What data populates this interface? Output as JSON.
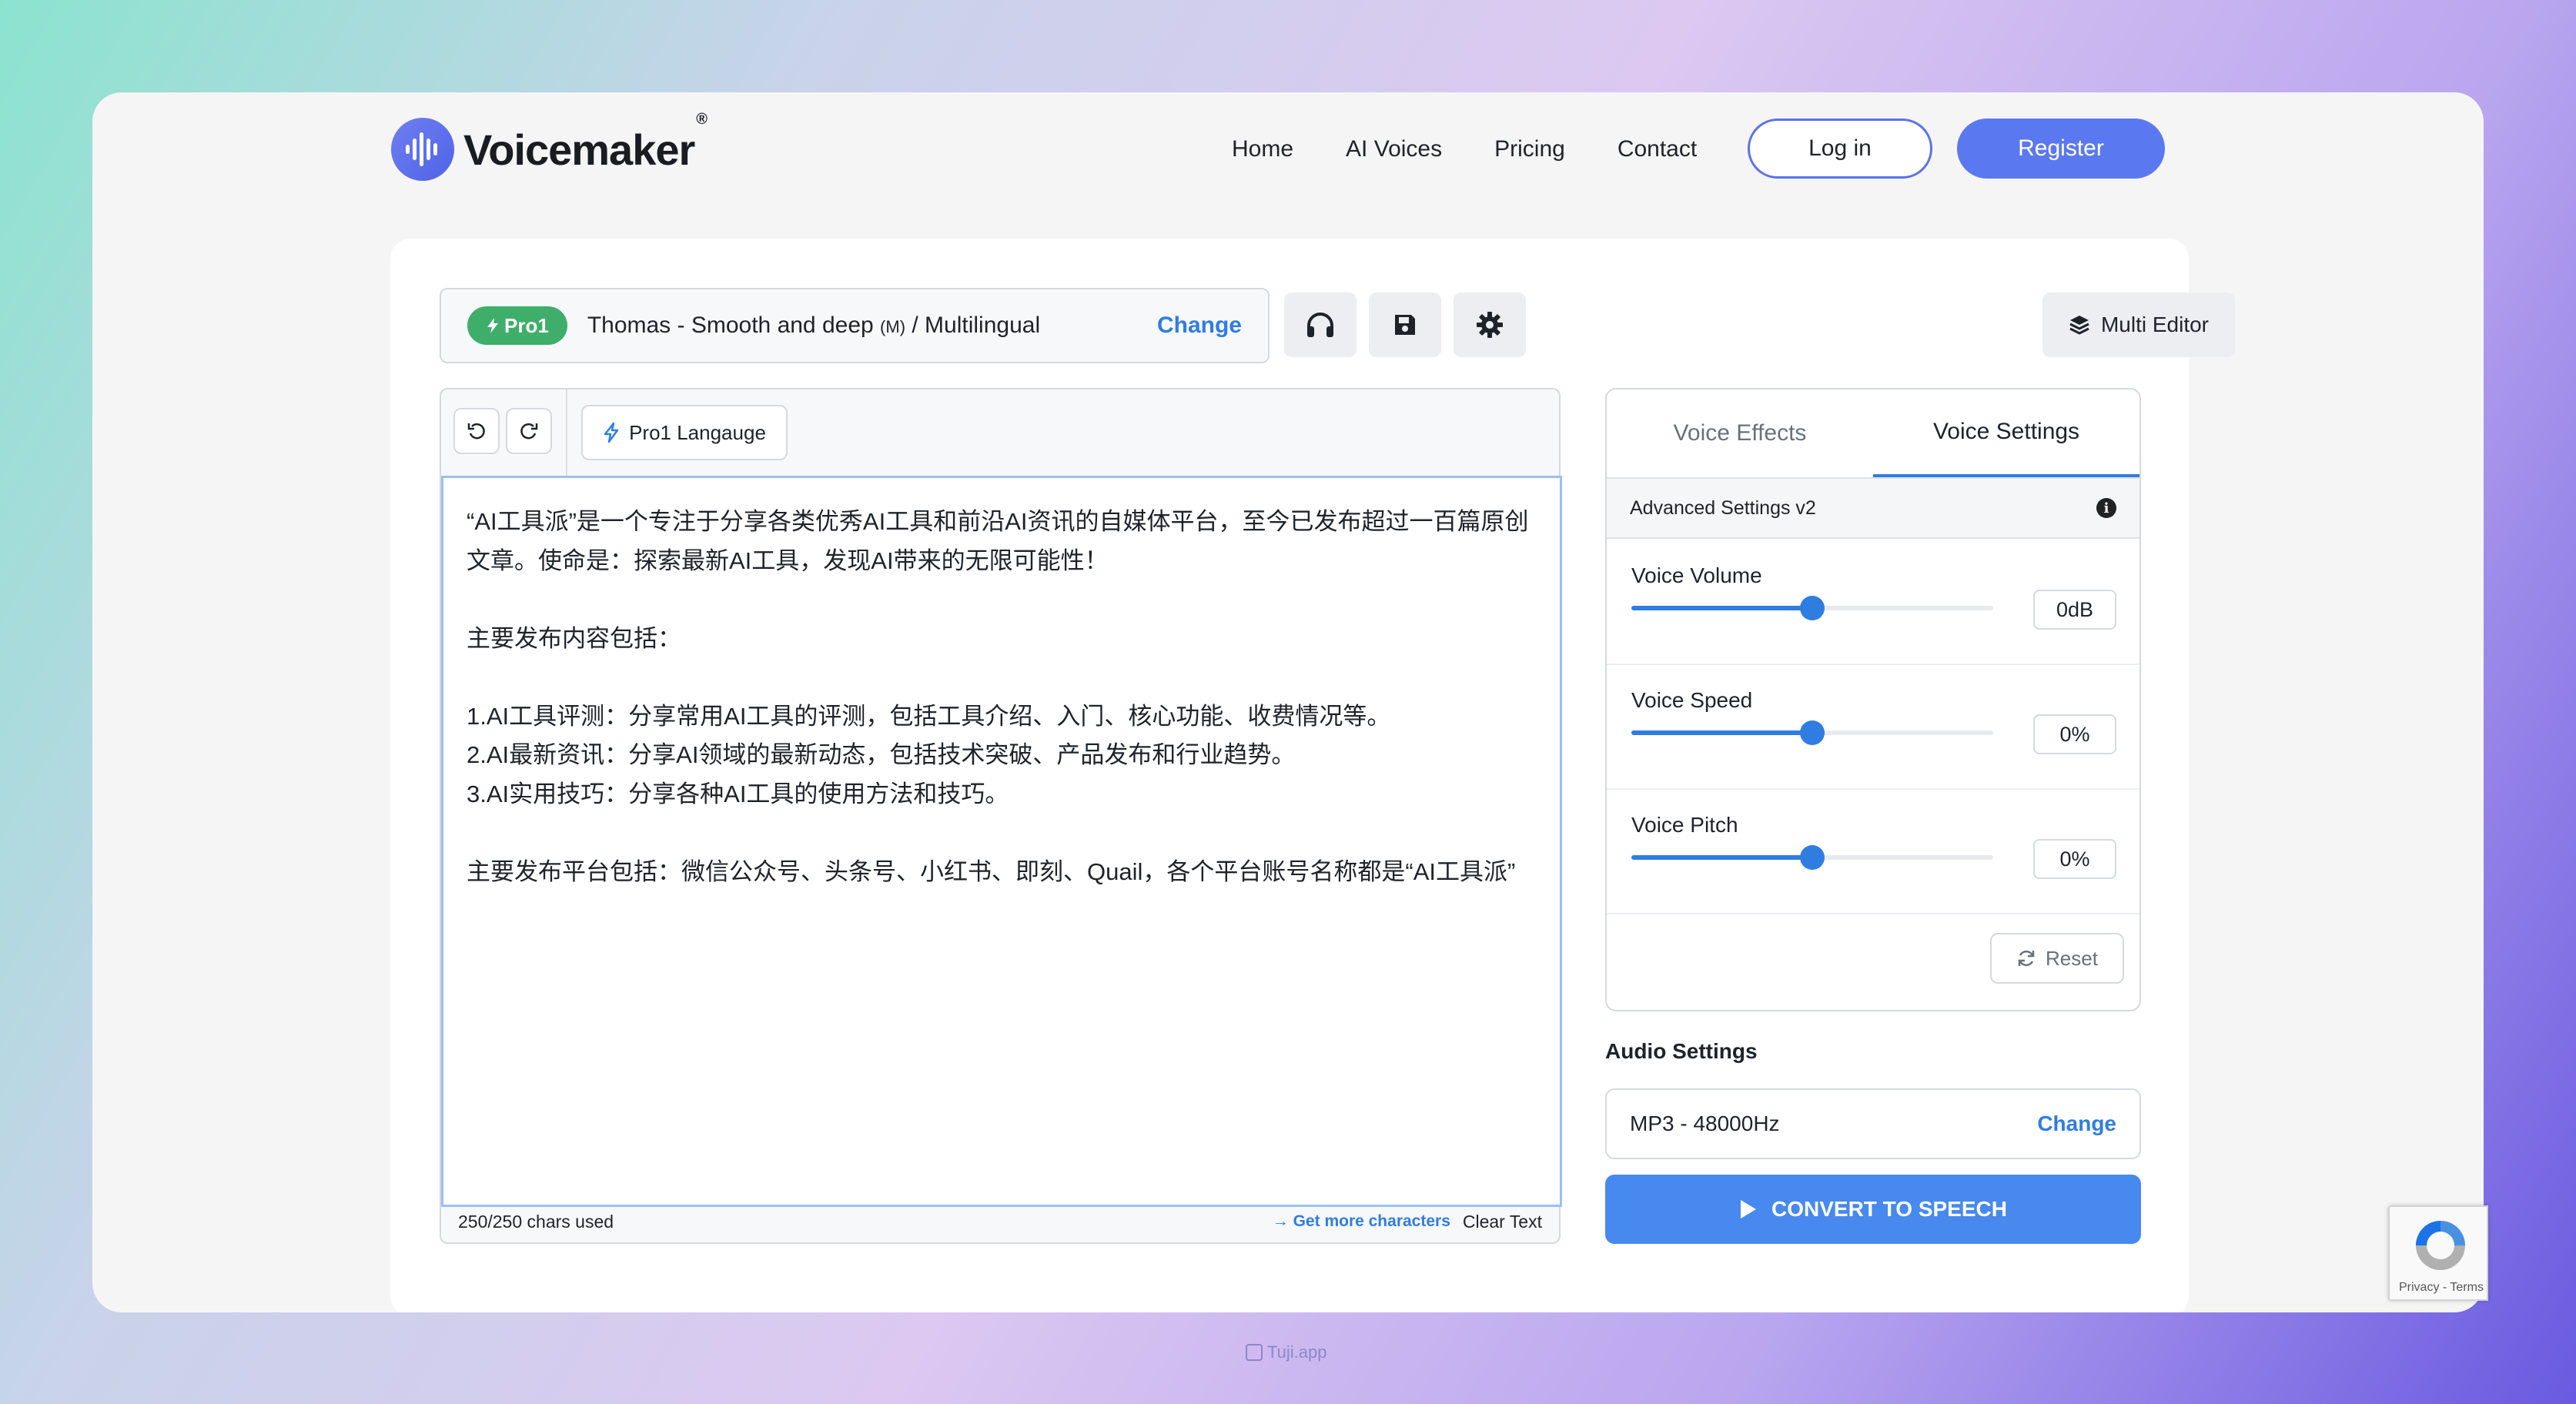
{
  "header": {
    "brand": "Voicemaker",
    "brand_mark": "®",
    "nav": [
      "Home",
      "AI Voices",
      "Pricing",
      "Contact"
    ],
    "login_label": "Log in",
    "register_label": "Register"
  },
  "voice_bar": {
    "badge": "Pro1",
    "voice_name": "Thomas - Smooth and deep",
    "gender": "(M)",
    "language": "/ Multilingual",
    "change_label": "Change"
  },
  "toolbar": {
    "multi_editor_label": "Multi Editor",
    "icons": [
      "headphones-icon",
      "save-icon",
      "gear-icon"
    ]
  },
  "editor": {
    "language_button": "Pro1 Langauge",
    "text": "“AI工具派”是一个专注于分享各类优秀AI工具和前沿AI资讯的自媒体平台，至今已发布超过一百篇原创文章。使命是：探索最新AI工具，发现AI带来的无限可能性！\n\n主要发布内容包括：\n\n1.AI工具评测：分享常用AI工具的评测，包括工具介绍、入门、核心功能、收费情况等。\n2.AI最新资讯：分享AI领域的最新动态，包括技术突破、产品发布和行业趋势。\n3.AI实用技巧：分享各种AI工具的使用方法和技巧。\n\n主要发布平台包括：微信公众号、头条号、小红书、即刻、Quail，各个平台账号名称都是“AI工具派”",
    "chars_used": "250/250 chars used",
    "get_more": "→ Get more characters",
    "clear": "Clear Text"
  },
  "settings": {
    "tabs": [
      "Voice Effects",
      "Voice Settings"
    ],
    "active_tab": "Voice Settings",
    "advanced_label": "Advanced Settings v2",
    "sliders": [
      {
        "label": "Voice Volume",
        "value": "0dB",
        "level": 0.5
      },
      {
        "label": "Voice Speed",
        "value": "0%",
        "level": 0.5
      },
      {
        "label": "Voice Pitch",
        "value": "0%",
        "level": 0.5
      }
    ],
    "reset_label": "Reset"
  },
  "audio": {
    "label": "Audio Settings",
    "format": "MP3 - 48000Hz",
    "change_label": "Change"
  },
  "convert_label": "CONVERT TO SPEECH",
  "recaptcha": {
    "text": "Privacy - Terms"
  },
  "watermark": "Tuji.app",
  "colors": {
    "accent": "#2f7de1",
    "brand": "#5a78f0",
    "pro_badge": "#3fae6a",
    "convert": "#4789ee"
  }
}
